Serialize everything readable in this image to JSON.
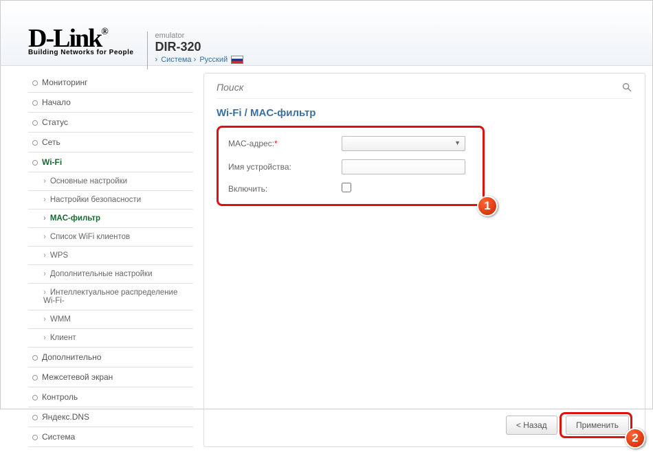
{
  "header": {
    "emulator": "emulator",
    "model": "DIR-320",
    "bc_system": "Система",
    "bc_lang": "Русский",
    "logo_sub": "Building Networks for People"
  },
  "search": {
    "placeholder": "Поиск"
  },
  "nav": {
    "items": [
      "Мониторинг",
      "Начало",
      "Статус",
      "Сеть",
      "Wi-Fi",
      "Дополнительно",
      "Межсетевой экран",
      "Контроль",
      "Яндекс.DNS",
      "Система"
    ],
    "wifi_sub": [
      "Основные настройки",
      "Настройки безопасности",
      "MAC-фильтр",
      "Список WiFi клиентов",
      "WPS",
      "Дополнительные настройки",
      "Интеллектуальное распределение Wi-Fi-",
      "WMM",
      "Клиент"
    ]
  },
  "page": {
    "title": "Wi-Fi  /  MAC-фильтр",
    "mac_label": "MAC-адрес:",
    "dev_label": "Имя устройства:",
    "enable_label": "Включить:"
  },
  "buttons": {
    "back": "< Назад",
    "apply": "Применить"
  },
  "badges": {
    "b1": "1",
    "b2": "2"
  }
}
